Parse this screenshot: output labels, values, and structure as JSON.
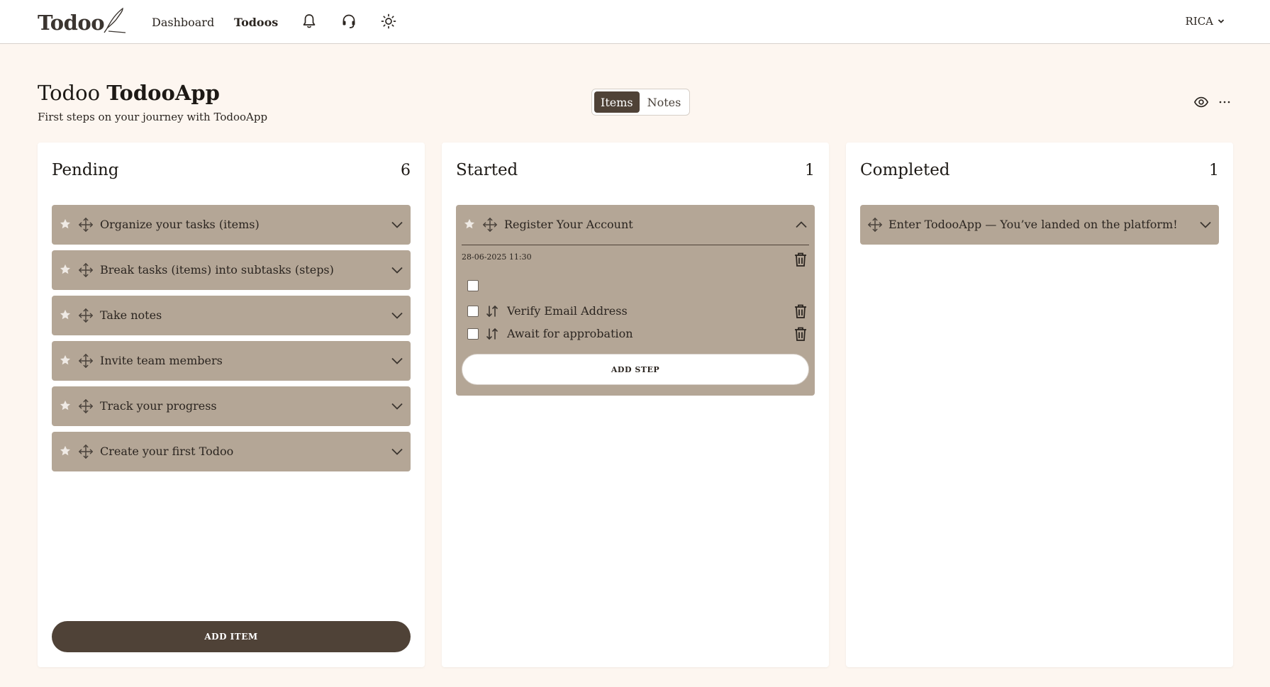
{
  "app": {
    "logo_text": "Todoo"
  },
  "nav": {
    "links": [
      {
        "label": "Dashboard"
      },
      {
        "label": "Todoos"
      }
    ],
    "user_label": "RICA"
  },
  "page": {
    "title_prefix": "Todoo",
    "title_name": "TodooApp",
    "subtitle": "First steps on your journey with TodooApp"
  },
  "view_toggle": {
    "items_label": "Items",
    "notes_label": "Notes",
    "selected": "Items"
  },
  "columns": {
    "pending": {
      "title": "Pending",
      "count": "6",
      "items": [
        {
          "label": "Organize your tasks (items)"
        },
        {
          "label": "Break tasks (items) into subtasks (steps)"
        },
        {
          "label": "Take notes"
        },
        {
          "label": "Invite team members"
        },
        {
          "label": "Track your progress"
        },
        {
          "label": "Create your first Todoo"
        }
      ],
      "add_item_label": "ADD ITEM"
    },
    "started": {
      "title": "Started",
      "count": "1",
      "item": {
        "label": "Register Your Account",
        "date": "28-06-2025 11:30",
        "steps": [
          {
            "label": ""
          },
          {
            "label": "Verify Email Address"
          },
          {
            "label": "Await for approbation"
          }
        ],
        "add_step_label": "ADD STEP"
      }
    },
    "completed": {
      "title": "Completed",
      "count": "1",
      "items": [
        {
          "label": "Enter TodooApp — You’ve landed on the platform!"
        }
      ]
    }
  },
  "colors": {
    "accent_dark": "#4f4237",
    "card_bg": "#b4a696",
    "page_bg": "#fdf6f0"
  }
}
